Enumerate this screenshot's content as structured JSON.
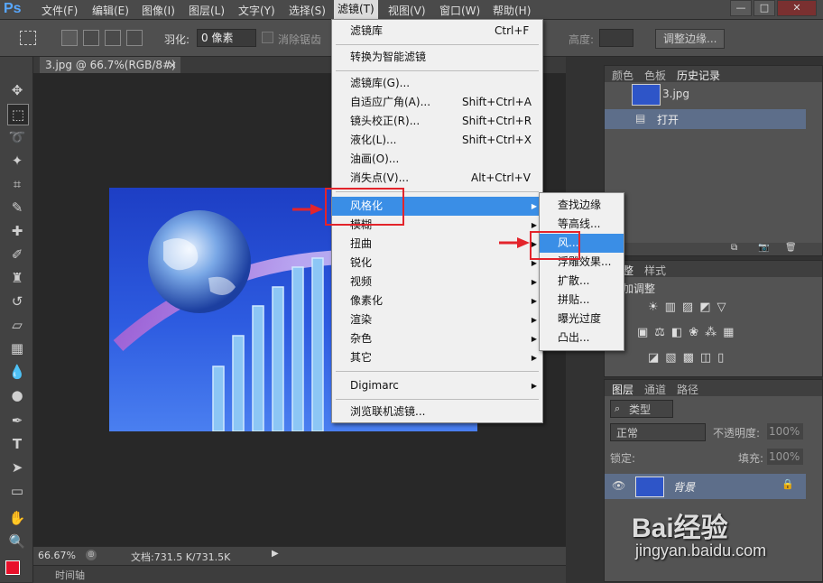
{
  "app": {
    "logo": "Ps"
  },
  "menubar": {
    "items": [
      "文件(F)",
      "编辑(E)",
      "图像(I)",
      "图层(L)",
      "文字(Y)",
      "选择(S)",
      "滤镜(T)",
      "视图(V)",
      "窗口(W)",
      "帮助(H)"
    ],
    "active_index": 6
  },
  "window_controls": {
    "minimize": "—",
    "restore": "□",
    "close": "✕"
  },
  "options": {
    "feather_label": "羽化:",
    "feather_value": "0 像素",
    "antialias_label": "消除锯齿",
    "height_label": "高度:",
    "refine_button": "调整边缘..."
  },
  "document": {
    "tab_label": "3.jpg @ 66.7%(RGB/8#)",
    "tab_close": "×",
    "zoom": "66.67%",
    "doc_size": "文档:731.5 K/731.5K",
    "timeline": "时间轴"
  },
  "filter_menu": {
    "items": [
      {
        "label": "滤镜库",
        "shortcut": "Ctrl+F"
      },
      {
        "label": "转换为智能滤镜",
        "shortcut": ""
      },
      {
        "label": "滤镜库(G)...",
        "shortcut": ""
      },
      {
        "label": "自适应广角(A)...",
        "shortcut": "Shift+Ctrl+A"
      },
      {
        "label": "镜头校正(R)...",
        "shortcut": "Shift+Ctrl+R"
      },
      {
        "label": "液化(L)...",
        "shortcut": "Shift+Ctrl+X"
      },
      {
        "label": "油画(O)...",
        "shortcut": ""
      },
      {
        "label": "消失点(V)...",
        "shortcut": "Alt+Ctrl+V"
      },
      {
        "label": "风格化",
        "shortcut": ""
      },
      {
        "label": "模糊",
        "shortcut": ""
      },
      {
        "label": "扭曲",
        "shortcut": ""
      },
      {
        "label": "锐化",
        "shortcut": ""
      },
      {
        "label": "视频",
        "shortcut": ""
      },
      {
        "label": "像素化",
        "shortcut": ""
      },
      {
        "label": "渲染",
        "shortcut": ""
      },
      {
        "label": "杂色",
        "shortcut": ""
      },
      {
        "label": "其它",
        "shortcut": ""
      },
      {
        "label": "Digimarc",
        "shortcut": ""
      },
      {
        "label": "浏览联机滤镜...",
        "shortcut": ""
      }
    ]
  },
  "stylize_submenu": {
    "items": [
      "查找边缘",
      "等高线...",
      "风...",
      "浮雕效果...",
      "扩散...",
      "拼贴...",
      "曝光过度",
      "凸出..."
    ]
  },
  "history_panel": {
    "tabs": [
      "颜色",
      "色板",
      "历史记录"
    ],
    "snapshot": "3.jpg",
    "step": "打开"
  },
  "adjust_panel": {
    "tabs": [
      "调整",
      "样式"
    ],
    "title": "添加调整"
  },
  "layers_panel": {
    "tabs": [
      "图层",
      "通道",
      "路径"
    ],
    "filter_kind": "类型",
    "blend_mode": "正常",
    "opacity_label": "不透明度:",
    "opacity_value": "100%",
    "lock_label": "锁定:",
    "fill_label": "填充:",
    "fill_value": "100%",
    "layer_name": "背景"
  },
  "watermark": {
    "brand": "Bai经验",
    "url": "jingyan.baidu.com"
  },
  "colors": {
    "highlight": "#3a8ee6",
    "annotation_red": "#e3242b"
  }
}
